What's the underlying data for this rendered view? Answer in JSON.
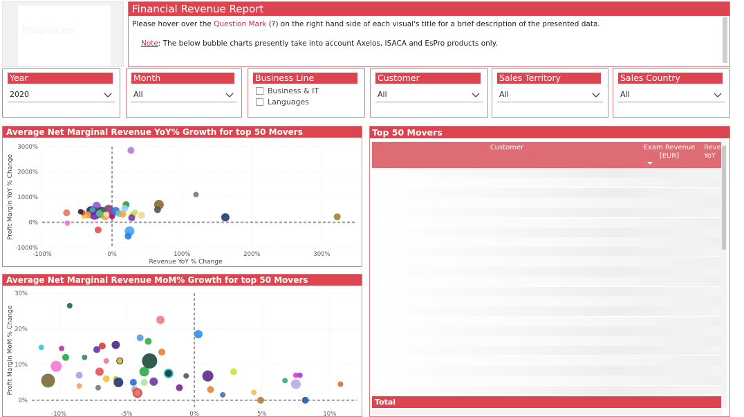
{
  "logo": {
    "text": "Peoplecert"
  },
  "report": {
    "title": "Financial Revenue Report",
    "line1_pre": "Please hover over the ",
    "line1_link": "Question Mark",
    "line1_post": " (?) on the right hand side of each visual's title for a brief description of the presented data.",
    "note_label": "Note",
    "note_text": ": The below bubble charts presently take into account Axelos, ISACA and EsPro products only."
  },
  "slicers": {
    "year": {
      "title": "Year",
      "value": "2020"
    },
    "month": {
      "title": "Month",
      "value": "All"
    },
    "business_line": {
      "title": "Business Line",
      "options": [
        "Business & IT",
        "Languages"
      ]
    },
    "customer": {
      "title": "Customer",
      "value": "All"
    },
    "sales_territory": {
      "title": "Sales Territory",
      "value": "All"
    },
    "sales_country": {
      "title": "Sales Country",
      "value": "All"
    }
  },
  "chart_data": [
    {
      "type": "scatter",
      "title": "Average Net Marginal Revenue YoY% Growth for top 50 Movers",
      "xlabel": "Revenue YoY % Change",
      "ylabel": "Profit Margin YoY % Change",
      "xlim": [
        -100,
        350
      ],
      "ylim": [
        -1000,
        3000
      ],
      "x_ticks": [
        -100,
        0,
        100,
        200,
        300
      ],
      "x_tick_labels": [
        "-100%",
        "0%",
        "100%",
        "200%",
        "300%"
      ],
      "y_ticks": [
        -1000,
        0,
        1000,
        2000,
        3000
      ],
      "y_tick_labels": [
        "-1000%",
        "0%",
        "1000%",
        "2000%",
        "3000%"
      ],
      "grid": true,
      "points": [
        {
          "x": 27,
          "y": 2850,
          "r": 5,
          "color": "#b57cd6"
        },
        {
          "x": 120,
          "y": 1100,
          "r": 4,
          "color": "#777777"
        },
        {
          "x": 67,
          "y": 700,
          "r": 7,
          "color": "#8a6d2d"
        },
        {
          "x": 65,
          "y": 500,
          "r": 5,
          "color": "#555555"
        },
        {
          "x": 162,
          "y": 200,
          "r": 6,
          "color": "#1e3a78"
        },
        {
          "x": 322,
          "y": 220,
          "r": 5,
          "color": "#a08530"
        },
        {
          "x": -65,
          "y": 380,
          "r": 5,
          "color": "#e8765a"
        },
        {
          "x": -64,
          "y": -30,
          "r": 4,
          "color": "#e67ad8"
        },
        {
          "x": -20,
          "y": -300,
          "r": 5,
          "color": "#e84c55"
        },
        {
          "x": 25,
          "y": -350,
          "r": 7,
          "color": "#3ea9f5"
        },
        {
          "x": 23,
          "y": -550,
          "r": 5,
          "color": "#2f7ce8"
        },
        {
          "x": -22,
          "y": 650,
          "r": 6,
          "color": "#8e5bd4"
        },
        {
          "x": 20,
          "y": 700,
          "r": 5,
          "color": "#2e9e3c"
        },
        {
          "x": -30,
          "y": 450,
          "r": 7,
          "color": "#1a2f6b"
        },
        {
          "x": -25,
          "y": 350,
          "r": 9,
          "color": "#7a2aa0"
        },
        {
          "x": -15,
          "y": 400,
          "r": 8,
          "color": "#2a5a3d"
        },
        {
          "x": -5,
          "y": 500,
          "r": 7,
          "color": "#8a3b7f"
        },
        {
          "x": 0,
          "y": 300,
          "r": 5,
          "color": "#b03090"
        },
        {
          "x": 5,
          "y": 450,
          "r": 6,
          "color": "#3c76c9"
        },
        {
          "x": -35,
          "y": 300,
          "r": 5,
          "color": "#f09a3e"
        },
        {
          "x": -40,
          "y": 250,
          "r": 4,
          "color": "#f5c842"
        },
        {
          "x": -10,
          "y": 250,
          "r": 6,
          "color": "#e3b03c"
        },
        {
          "x": 10,
          "y": 350,
          "r": 5,
          "color": "#5ec0e8"
        },
        {
          "x": 18,
          "y": 550,
          "r": 5,
          "color": "#9fcfef"
        },
        {
          "x": 30,
          "y": 300,
          "r": 5,
          "color": "#d2dc52"
        },
        {
          "x": 33,
          "y": 400,
          "r": 4,
          "color": "#c7e06a"
        },
        {
          "x": 42,
          "y": 280,
          "r": 5,
          "color": "#f2d68e"
        },
        {
          "x": -18,
          "y": 350,
          "r": 5,
          "color": "#58c39b"
        },
        {
          "x": -28,
          "y": 500,
          "r": 4,
          "color": "#37b6b3"
        },
        {
          "x": -42,
          "y": 380,
          "r": 4,
          "color": "#d94f4f"
        },
        {
          "x": -45,
          "y": 420,
          "r": 4,
          "color": "#2d2d2d"
        },
        {
          "x": 15,
          "y": 320,
          "r": 5,
          "color": "#e8ac3c"
        },
        {
          "x": -8,
          "y": 320,
          "r": 4,
          "color": "#f3e3a5"
        },
        {
          "x": 28,
          "y": 180,
          "r": 5,
          "color": "#7b3fa1"
        },
        {
          "x": 0,
          "y": 220,
          "r": 4,
          "color": "#a0207a"
        }
      ]
    },
    {
      "type": "scatter",
      "title": "Average Net Marginal Revenue MoM% Growth for top 50 Movers",
      "xlabel": "Revenue MoM % Change",
      "ylabel": "Profit Margin MoM % Change",
      "xlim": [
        -12,
        12
      ],
      "ylim": [
        -2,
        30
      ],
      "x_ticks": [
        -10,
        -5,
        0,
        5,
        10
      ],
      "x_tick_labels": [
        "-10%",
        "-5%",
        "0%",
        "5%",
        "10%"
      ],
      "y_ticks": [
        0,
        10,
        20,
        30
      ],
      "y_tick_labels": [
        "0%",
        "10%",
        "20%",
        "30%"
      ],
      "grid": true,
      "points": [
        {
          "x": -9.2,
          "y": 26.5,
          "r": 4,
          "color": "#1a6b3a"
        },
        {
          "x": -11.3,
          "y": 14.8,
          "r": 4,
          "color": "#37c6e8"
        },
        {
          "x": -10.8,
          "y": 5.5,
          "r": 10,
          "color": "#7a6a3a"
        },
        {
          "x": -10.2,
          "y": 9.5,
          "r": 8,
          "color": "#f07ad0"
        },
        {
          "x": -9.5,
          "y": 12,
          "r": 5,
          "color": "#28a745"
        },
        {
          "x": -9.8,
          "y": 14.5,
          "r": 4,
          "color": "#b03a9a"
        },
        {
          "x": -8.5,
          "y": 7,
          "r": 5,
          "color": "#a0a8e8"
        },
        {
          "x": -8.1,
          "y": 12,
          "r": 4,
          "color": "#2e8b57"
        },
        {
          "x": -8.5,
          "y": 4,
          "r": 4,
          "color": "#f4a460"
        },
        {
          "x": -7.2,
          "y": 14.2,
          "r": 5,
          "color": "#6b2fb0"
        },
        {
          "x": -6.8,
          "y": 15.2,
          "r": 5,
          "color": "#d93b3b"
        },
        {
          "x": -6.5,
          "y": 11,
          "r": 4,
          "color": "#e87aa0"
        },
        {
          "x": -5.8,
          "y": 15.5,
          "r": 6,
          "color": "#4a2a8a"
        },
        {
          "x": -5.5,
          "y": 11,
          "r": 5,
          "color": "#1a1a1a"
        },
        {
          "x": -5.5,
          "y": 11,
          "r": 4,
          "color": "#e8d35a"
        },
        {
          "x": -7,
          "y": 8,
          "r": 6,
          "color": "#e84c55"
        },
        {
          "x": -6.5,
          "y": 6,
          "r": 5,
          "color": "#f3c13a"
        },
        {
          "x": -5.8,
          "y": 6,
          "r": 4,
          "color": "#cfc14a"
        },
        {
          "x": -5.6,
          "y": 5,
          "r": 7,
          "color": "#24356f"
        },
        {
          "x": -7.1,
          "y": 3.5,
          "r": 4,
          "color": "#777777"
        },
        {
          "x": -4.5,
          "y": 5,
          "r": 5,
          "color": "#2a6fd6"
        },
        {
          "x": -4.4,
          "y": 3,
          "r": 5,
          "color": "#a8a8a8"
        },
        {
          "x": -4.2,
          "y": 2,
          "r": 7,
          "color": "#d83a3a"
        },
        {
          "x": -4.2,
          "y": 2,
          "r": 5,
          "color": "#e08080"
        },
        {
          "x": -4,
          "y": 17.5,
          "r": 5,
          "color": "#5a9ae8"
        },
        {
          "x": -3.7,
          "y": 8,
          "r": 7,
          "color": "#2ea84a"
        },
        {
          "x": -3.7,
          "y": 5,
          "r": 5,
          "color": "#a8e8a8"
        },
        {
          "x": -3.4,
          "y": 16.5,
          "r": 5,
          "color": "#3aa84a"
        },
        {
          "x": -3.3,
          "y": 11,
          "r": 11,
          "color": "#1a4a3a"
        },
        {
          "x": -3,
          "y": 5.2,
          "r": 6,
          "color": "#6a3aa0"
        },
        {
          "x": -2.5,
          "y": 22.5,
          "r": 6,
          "color": "#f08080"
        },
        {
          "x": -2.4,
          "y": 13.5,
          "r": 5,
          "color": "#f07a30"
        },
        {
          "x": -1.9,
          "y": 7.5,
          "r": 7,
          "color": "#2ab8b8"
        },
        {
          "x": -1.9,
          "y": 7.5,
          "r": 5,
          "color": "#1a3a4a"
        },
        {
          "x": -1.1,
          "y": 3.5,
          "r": 5,
          "color": "#7a2a8a"
        },
        {
          "x": -0.6,
          "y": 6.8,
          "r": 4,
          "color": "#555555"
        },
        {
          "x": 0.3,
          "y": 18.5,
          "r": 6,
          "color": "#2a90e8"
        },
        {
          "x": 1,
          "y": 6.8,
          "r": 8,
          "color": "#5a2a8a"
        },
        {
          "x": 1.2,
          "y": 3,
          "r": 5,
          "color": "#e8843a"
        },
        {
          "x": 2.1,
          "y": 1.5,
          "r": 4,
          "color": "#4a6ab8"
        },
        {
          "x": 2.9,
          "y": 8,
          "r": 5,
          "color": "#c8e83a"
        },
        {
          "x": 4.4,
          "y": 2.2,
          "r": 4,
          "color": "#f3c25a"
        },
        {
          "x": 4.9,
          "y": 0,
          "r": 5,
          "color": "#b08030"
        },
        {
          "x": 6.7,
          "y": 5.5,
          "r": 4,
          "color": "#3aa88a"
        },
        {
          "x": 7.5,
          "y": 4.5,
          "r": 7,
          "color": "#b8a8e8"
        },
        {
          "x": 7.5,
          "y": 7,
          "r": 4,
          "color": "#e83ad8"
        },
        {
          "x": 7.8,
          "y": 7,
          "r": 4,
          "color": "#a83ae8"
        },
        {
          "x": 8.2,
          "y": 0,
          "r": 5,
          "color": "#2a5aa8"
        },
        {
          "x": 10.8,
          "y": 4.5,
          "r": 4,
          "color": "#e06a3a"
        }
      ]
    }
  ],
  "table": {
    "title": "Top 50 Movers",
    "columns": [
      "Customer",
      "Exam Revenue [EUR]",
      "Reve YoY"
    ],
    "total_label": "Total"
  }
}
